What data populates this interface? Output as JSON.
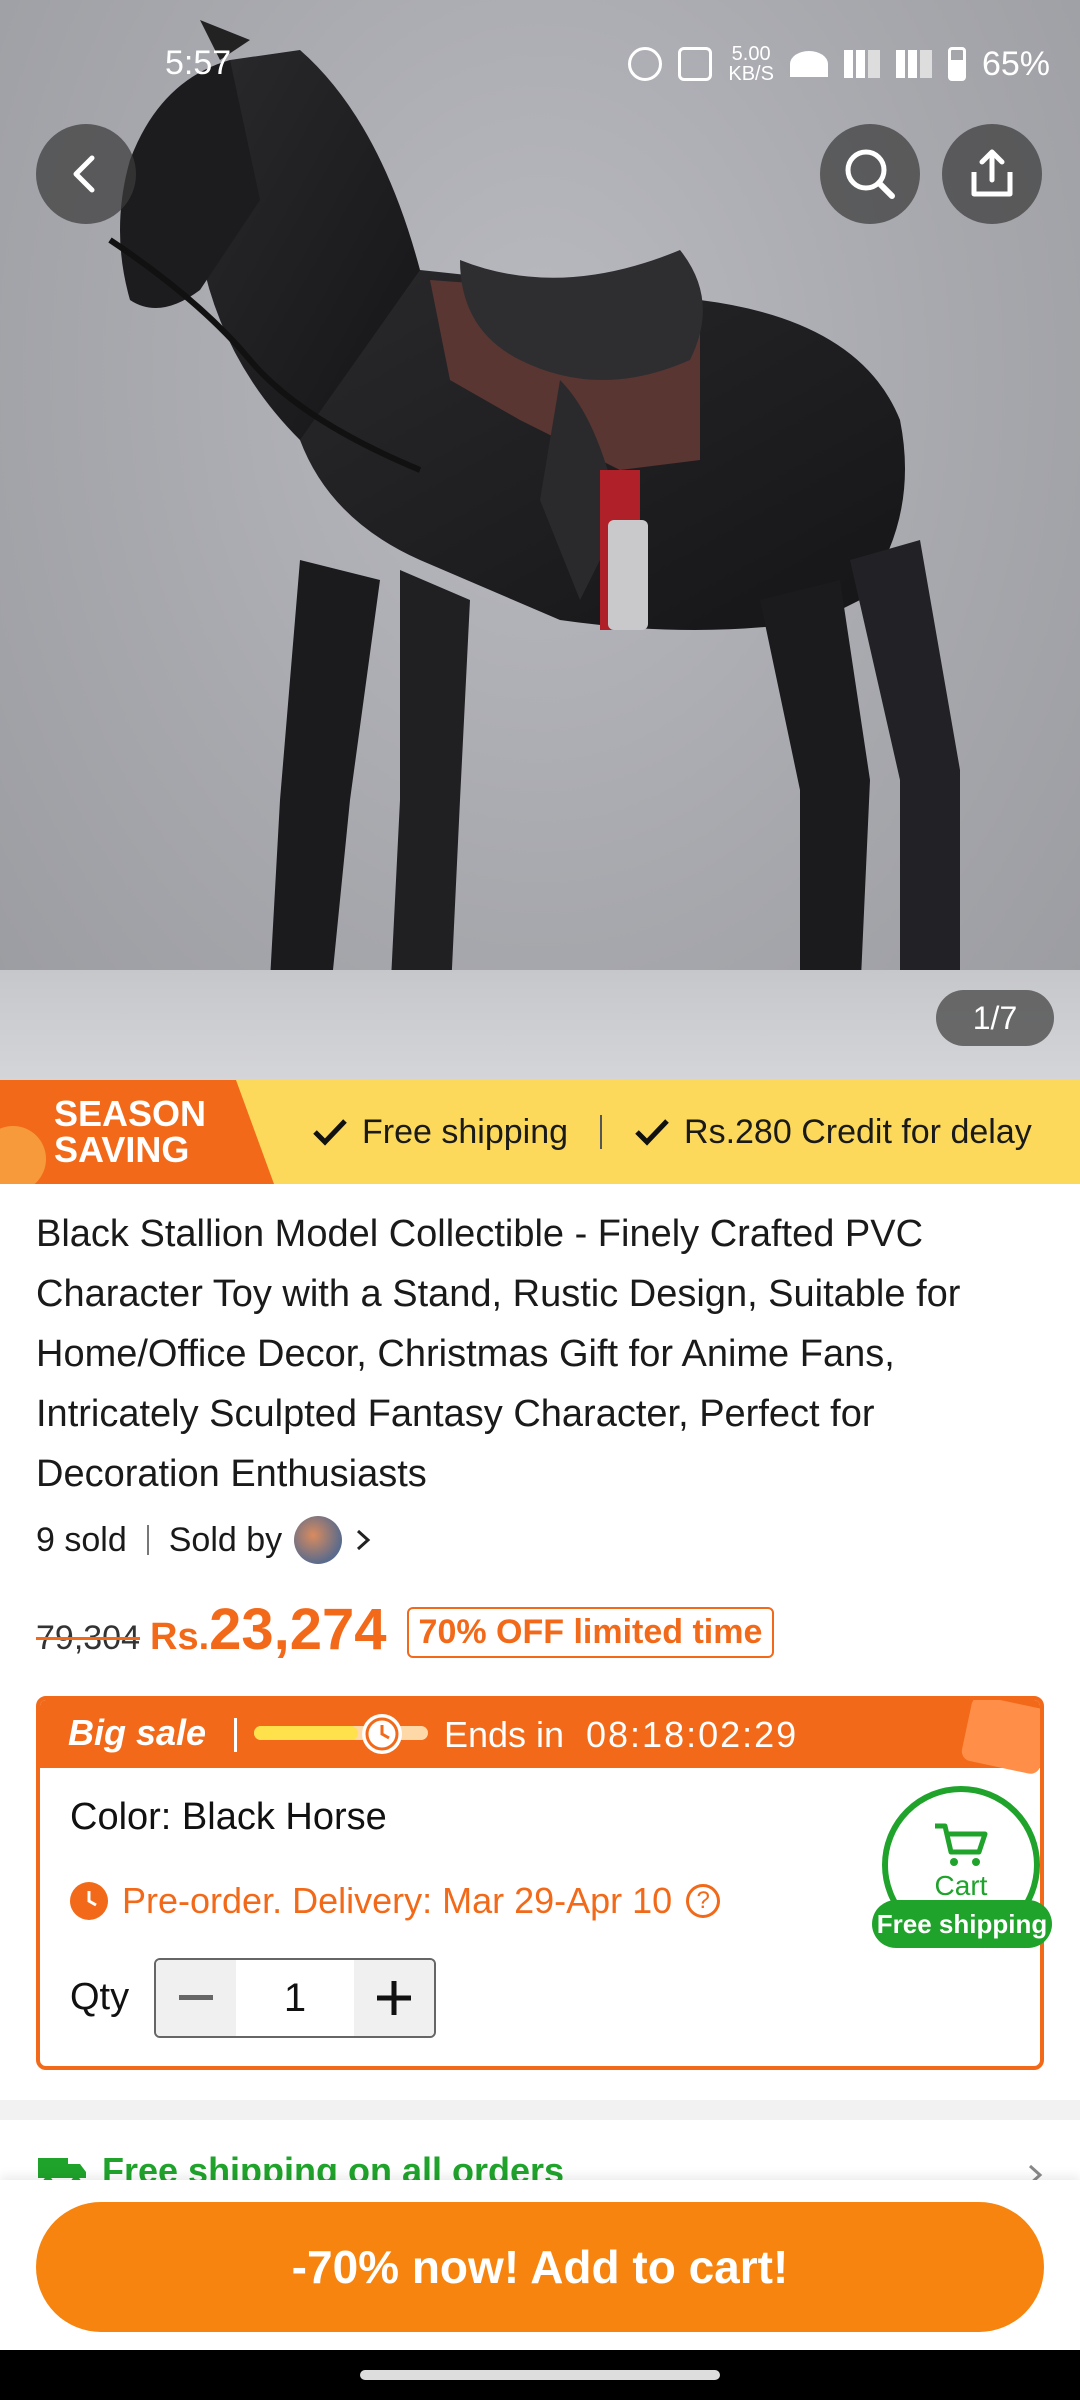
{
  "status_bar": {
    "time": "5:57",
    "network_speed": "5.00",
    "network_unit": "KB/S",
    "battery": "65%"
  },
  "gallery": {
    "counter": "1/7"
  },
  "promo_banner": {
    "season_line1": "SEASON",
    "season_line2": "SAVING",
    "item1": "Free shipping",
    "item2": "Rs.280 Credit for delay"
  },
  "product": {
    "title": "Black Stallion Model Collectible - Finely Crafted PVC Character Toy with a Stand, Rustic Design, Suitable for Home/Office Decor, Christmas Gift for Anime Fans, Intricately Sculpted Fantasy Character, Perfect for Decoration Enthusiasts",
    "sold": "9 sold",
    "sold_by": "Sold by"
  },
  "price": {
    "original": "79,304",
    "currency": "Rs.",
    "current": "23,274",
    "discount_tag": "70% OFF limited time"
  },
  "sale": {
    "label": "Big sale",
    "progress": 0.6,
    "ends_label": "Ends in",
    "countdown": "08:18:02:29"
  },
  "options": {
    "color": "Color: Black Horse",
    "preorder": "Pre-order. Delivery: Mar 29-Apr 10",
    "help": "?",
    "qty_label": "Qty",
    "qty_value": "1",
    "minus": "−",
    "plus": "+"
  },
  "cart_float": {
    "label": "Cart",
    "badge": "Free shipping"
  },
  "shipping_row": {
    "text": "Free shipping on all orders"
  },
  "cta": {
    "label": "-70% now! Add to cart!"
  },
  "colors": {
    "accent": "#f26a19",
    "cta": "#f7840e",
    "green": "#1fa32b",
    "banner": "#fcd95a"
  }
}
